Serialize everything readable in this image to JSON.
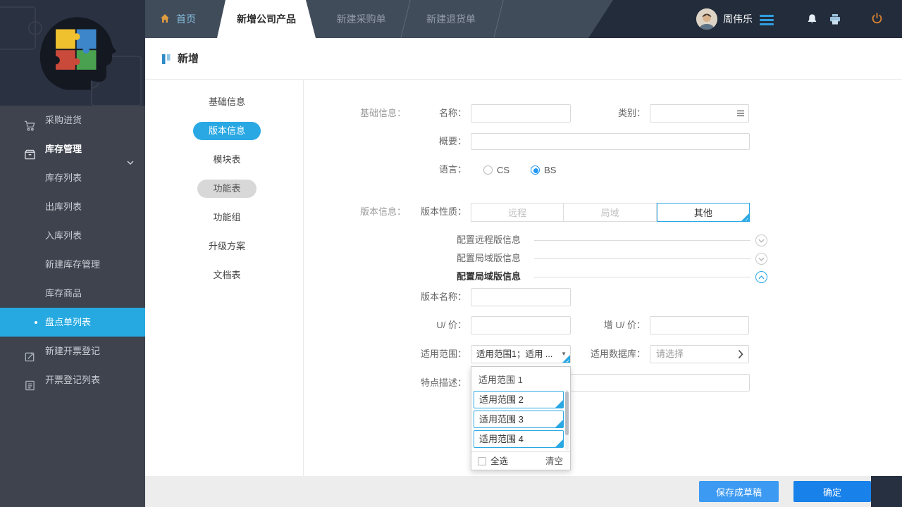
{
  "topbar": {
    "tabs": [
      {
        "label": "首页",
        "active": false
      },
      {
        "label": "新增公司产品",
        "active": true
      },
      {
        "label": "新建采购单",
        "active": false
      },
      {
        "label": "新建退货单",
        "active": false
      }
    ],
    "user": {
      "name": "周伟乐"
    }
  },
  "sidebar": {
    "items": [
      {
        "label": "采购进货",
        "icon": "cart-icon",
        "level": 1
      },
      {
        "label": "库存管理",
        "icon": "inventory-icon",
        "level": 1,
        "expanded": true
      },
      {
        "label": "库存列表",
        "level": 2
      },
      {
        "label": "出库列表",
        "level": 2
      },
      {
        "label": "入库列表",
        "level": 2
      },
      {
        "label": "新建库存管理",
        "level": 2
      },
      {
        "label": "库存商品",
        "level": 2
      },
      {
        "label": "盘点单列表",
        "level": 2,
        "active": true
      },
      {
        "label": "新建开票登记",
        "icon": "edit-icon",
        "level": 1
      },
      {
        "label": "开票登记列表",
        "icon": "document-icon",
        "level": 1
      }
    ]
  },
  "page": {
    "title": "新增",
    "steps": [
      {
        "label": "基础信息",
        "state": "normal"
      },
      {
        "label": "版本信息",
        "state": "active"
      },
      {
        "label": "模块表",
        "state": "normal"
      },
      {
        "label": "功能表",
        "state": "gray"
      },
      {
        "label": "功能组",
        "state": "normal"
      },
      {
        "label": "升级方案",
        "state": "normal"
      },
      {
        "label": "文档表",
        "state": "normal"
      }
    ]
  },
  "form": {
    "basic_section": "基础信息：",
    "name_label": "名称：",
    "category_label": "类别：",
    "summary_label": "概要：",
    "language_label": "语言：",
    "cs": "CS",
    "bs": "BS",
    "language_selected": "BS",
    "version_section": "版本信息：",
    "version_type_label": "版本性质：",
    "seg": {
      "remote": "远程",
      "lan": "局域",
      "other": "其他",
      "selected": "其他"
    },
    "collapse_remote": "配置远程版信息",
    "collapse_lan": "配置局域版信息",
    "collapse_lan_expanded": "配置局域版信息",
    "version_name_label": "版本名称：",
    "u_price_label": "U/ 价：",
    "add_u_price_label": "增 U/ 价：",
    "scope_label": "适用范围：",
    "scope_value": "适用范围1；适用 ...",
    "database_label": "适用数据库：",
    "database_value": "请选择",
    "feature_label": "特点描述："
  },
  "dropdown": {
    "options": [
      {
        "label": "适用范围 1",
        "selected": false
      },
      {
        "label": "适用范围 2",
        "selected": true
      },
      {
        "label": "适用范围 3",
        "selected": true
      },
      {
        "label": "适用范围 4",
        "selected": true
      }
    ],
    "select_all": "全选",
    "clear": "清空"
  },
  "footer": {
    "save_draft": "保存成草稿",
    "confirm": "确定"
  },
  "icons": {
    "check": "✓",
    "caret_down": "▼"
  },
  "colors": {
    "accent": "#29a8e4",
    "topbar": "#222c3b",
    "tabstrip": "#414c5b",
    "sidebar": "#3e434e",
    "active_row": "#26a9e0",
    "button_draft": "#3d9af2",
    "button_confirm": "#1981ea",
    "power_icon": "#df8430",
    "home_icon": "#e09c40"
  }
}
